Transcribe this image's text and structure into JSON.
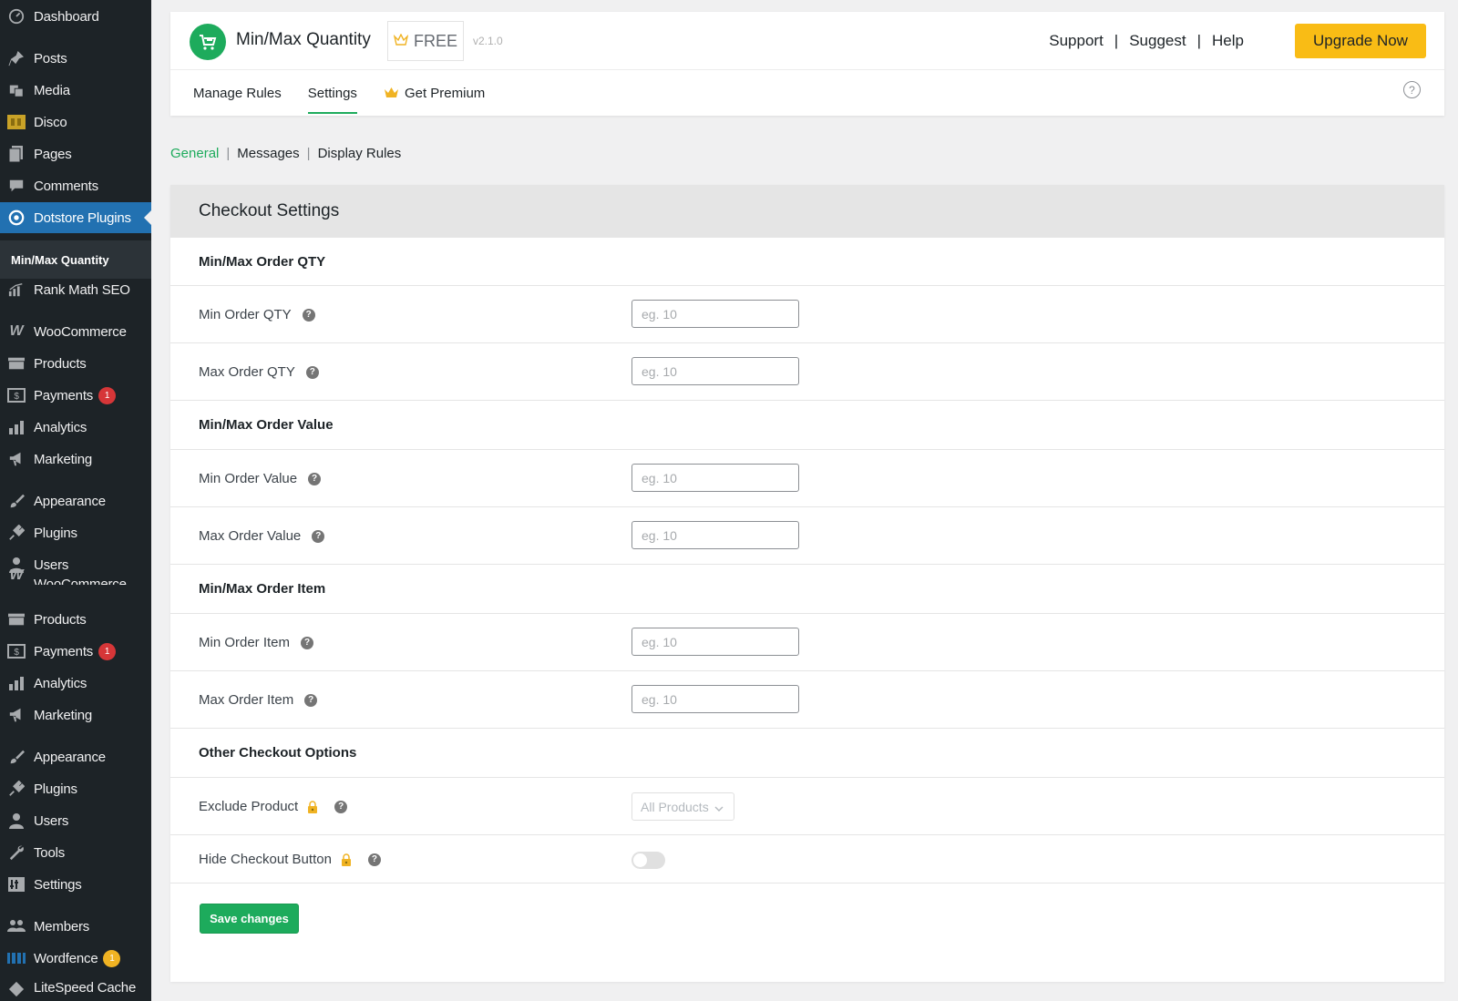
{
  "sidebar": {
    "items": [
      {
        "label": "Dashboard",
        "icon": "dashboard-icon"
      },
      {
        "label": "Posts",
        "icon": "pin-icon"
      },
      {
        "label": "Media",
        "icon": "media-icon"
      },
      {
        "label": "Disco",
        "icon": "disco-icon"
      },
      {
        "label": "Pages",
        "icon": "pages-icon"
      },
      {
        "label": "Comments",
        "icon": "comments-icon"
      },
      {
        "label": "Dotstore Plugins",
        "icon": "dotstore-icon"
      },
      {
        "label": "Min/Max Quantity"
      },
      {
        "label": "Rank Math SEO",
        "icon": "chart-icon"
      },
      {
        "label": "WooCommerce",
        "icon": "woo-icon"
      },
      {
        "label": "Products",
        "icon": "products-icon"
      },
      {
        "label": "Payments",
        "icon": "payments-icon",
        "badge": "1"
      },
      {
        "label": "Analytics",
        "icon": "analytics-icon"
      },
      {
        "label": "Marketing",
        "icon": "megaphone-icon"
      },
      {
        "label": "Appearance",
        "icon": "brush-icon"
      },
      {
        "label": "Plugins",
        "icon": "plugin-icon"
      },
      {
        "label": "Users",
        "icon": "user-icon"
      },
      {
        "label": "WooCommerce",
        "icon": "woo-icon"
      },
      {
        "label": "Products",
        "icon": "products-icon"
      },
      {
        "label": "Payments",
        "icon": "payments-icon",
        "badge": "1"
      },
      {
        "label": "Analytics",
        "icon": "analytics-icon"
      },
      {
        "label": "Marketing",
        "icon": "megaphone-icon"
      },
      {
        "label": "Appearance",
        "icon": "brush-icon"
      },
      {
        "label": "Plugins",
        "icon": "plugin-icon"
      },
      {
        "label": "Users",
        "icon": "user-icon"
      },
      {
        "label": "Tools",
        "icon": "wrench-icon"
      },
      {
        "label": "Settings",
        "icon": "settings-icon"
      },
      {
        "label": "Members",
        "icon": "members-icon"
      },
      {
        "label": "Wordfence",
        "icon": "wordfence-icon",
        "badge": "1"
      },
      {
        "label": "LiteSpeed Cache",
        "icon": "litespeed-icon"
      }
    ]
  },
  "header": {
    "plugin_title": "Min/Max Quantity",
    "free_label": "FREE",
    "version": "v2.1.0",
    "links": [
      "Support",
      "Suggest",
      "Help"
    ],
    "link_separator": "|",
    "upgrade_label": "Upgrade Now",
    "tabs": [
      "Manage Rules",
      "Settings",
      "Get Premium"
    ],
    "help_glyph": "?"
  },
  "subnav": {
    "items": [
      "General",
      "Messages",
      "Display Rules"
    ],
    "separator": "|"
  },
  "card": {
    "title": "Checkout Settings",
    "sections": [
      {
        "title": "Min/Max Order QTY",
        "fields": [
          {
            "label": "Min Order QTY",
            "placeholder": "eg. 10"
          },
          {
            "label": "Max Order QTY",
            "placeholder": "eg. 10"
          }
        ]
      },
      {
        "title": "Min/Max Order Value",
        "fields": [
          {
            "label": "Min Order Value",
            "placeholder": "eg. 10"
          },
          {
            "label": "Max Order Value",
            "placeholder": "eg. 10"
          }
        ]
      },
      {
        "title": "Min/Max Order Item",
        "fields": [
          {
            "label": "Min Order Item",
            "placeholder": "eg. 10"
          },
          {
            "label": "Max Order Item",
            "placeholder": "eg. 10"
          }
        ]
      },
      {
        "title": "Other Checkout Options",
        "fields": [
          {
            "label": "Exclude Product",
            "select_value": "All Products"
          },
          {
            "label": "Hide Checkout Button",
            "toggle": false
          }
        ]
      }
    ],
    "help_glyph": "?",
    "save_label": "Save changes"
  },
  "colors": {
    "accent_green": "#1dab5c",
    "upgrade_yellow": "#f9bc15",
    "sidebar_bg": "#1d2327",
    "sidebar_active": "#2271b1"
  }
}
